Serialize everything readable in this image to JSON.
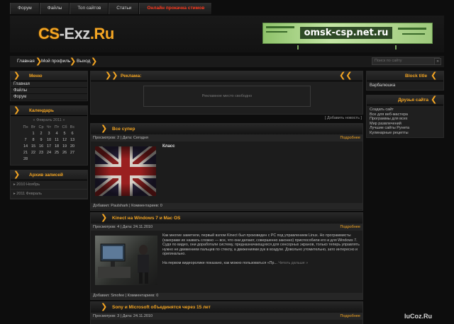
{
  "topnav": [
    "Форум",
    "Файлы",
    "Топ сайтов",
    "Статьи",
    "Онлайн прокачка стимов"
  ],
  "logo": {
    "part1": "CS",
    "part2": "-Exz",
    "part3": ".Ru"
  },
  "banner": {
    "text": "omsk-csp.net.ru"
  },
  "nav2": [
    "Главная",
    "Мой профиль",
    "Выход"
  ],
  "search": {
    "placeholder": "Поиск по сайту",
    "button": "»"
  },
  "left": {
    "menu": {
      "title": "Меню",
      "items": [
        "Главная",
        "Файлы",
        "Форум"
      ]
    },
    "calendar": {
      "title": "Календарь",
      "month": "« Февраль 2011 »",
      "days": [
        "Пн",
        "Вт",
        "Ср",
        "Чт",
        "Пт",
        "Сб",
        "Вс"
      ],
      "weeks": [
        [
          "",
          "1",
          "2",
          "3",
          "4",
          "5",
          "6"
        ],
        [
          "7",
          "8",
          "9",
          "10",
          "11",
          "12",
          "13"
        ],
        [
          "14",
          "15",
          "16",
          "17",
          "18",
          "19",
          "20"
        ],
        [
          "21",
          "22",
          "23",
          "24",
          "25",
          "26",
          "27"
        ],
        [
          "28",
          "",
          "",
          "",
          "",
          "",
          ""
        ]
      ]
    },
    "archive": {
      "title": "Архив записей",
      "items": [
        "2010 Ноябрь",
        "2011 Февраль"
      ]
    }
  },
  "center": {
    "ads": {
      "title": "Реклама:",
      "placeholder": "Рекламное место свободно"
    },
    "add_news": "[ Добавить новость ]",
    "news": [
      {
        "title": "Все супер",
        "meta": "Просмотров: 2 | Дата: Сегодня",
        "more": "Подробнее",
        "body_title": "Класс",
        "footer": "Добавил: Paulshark | Комментариев: 0"
      },
      {
        "title": "Kinect на Windows 7 и Mac OS",
        "meta": "Просмотров: 4 | Дата: 24.11.2010",
        "more": "Подробнее",
        "text1": "Как многие заметили, первый взлом Kinect был произведен с PC под управлением Linux. Но программисты (хакерами их назвать сложно — все, что они делают, совершенно законно) приспособили его и для Windows 7. Судя по видео, они доработали систему, предназначающуюся для сенсорных экранов, только теперь управлять нужно не движением пальцев по стеклу, а движениями рук в воздухе. Довольно утомительно, зато интересно и оригинально.",
        "text2": "На первом видеоролике показано, как можно пользоваться «Пр...",
        "read_more": "Читать дальше »",
        "footer": "Добавил: Smofee | Комментариев: 0"
      },
      {
        "title": "Sony и Microsoft объединятся через 15 лет",
        "meta": "Просмотров: 3 | Дата: 24.11.2010",
        "more": "Подробнее"
      }
    ]
  },
  "right": {
    "block": {
      "title": "Block title",
      "text": "Варбалюшка"
    },
    "friends": {
      "title": "Друзья сайта",
      "items": [
        "Создать сайт",
        "Все для веб-мастера",
        "Программы для всех",
        "Мир развлечений",
        "Лучшие сайты Рунета",
        "Кулинарные рецепты"
      ]
    }
  },
  "watermark": "IuCoz.Ru",
  "colors": {
    "accent": "#f5a623",
    "hot": "#ff3b1f",
    "bg": "#0d0d0d"
  }
}
